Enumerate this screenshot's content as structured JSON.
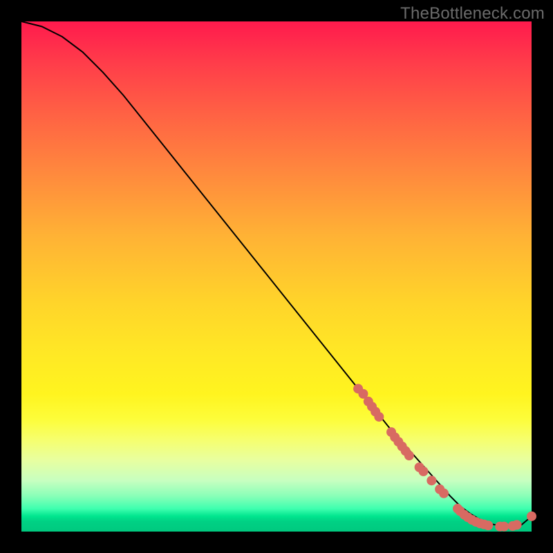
{
  "watermark": "TheBottleneck.com",
  "chart_data": {
    "type": "line",
    "title": "",
    "xlabel": "",
    "ylabel": "",
    "xlim": [
      0,
      100
    ],
    "ylim": [
      0,
      100
    ],
    "grid": false,
    "legend": false,
    "series": [
      {
        "name": "curve",
        "color": "#000000",
        "x": [
          0,
          4,
          8,
          12,
          16,
          20,
          24,
          28,
          32,
          36,
          40,
          44,
          48,
          52,
          56,
          60,
          64,
          68,
          72,
          76,
          80,
          84,
          86,
          88,
          90,
          92,
          94,
          96,
          98,
          100
        ],
        "y": [
          100,
          99,
          97,
          94,
          90,
          85.5,
          80.5,
          75.5,
          70.5,
          65.5,
          60.5,
          55.5,
          50.5,
          45.5,
          40.5,
          35.5,
          30.5,
          25.5,
          20.5,
          16,
          11.5,
          7,
          5,
          3.5,
          2.3,
          1.5,
          1.1,
          1.0,
          1.3,
          3.0
        ]
      }
    ],
    "scatter_points": {
      "name": "markers",
      "color": "#d86a62",
      "radius": 7,
      "points": [
        {
          "x": 66,
          "y": 28
        },
        {
          "x": 67,
          "y": 27
        },
        {
          "x": 68,
          "y": 25.5
        },
        {
          "x": 68.7,
          "y": 24.5
        },
        {
          "x": 69.4,
          "y": 23.5
        },
        {
          "x": 70.1,
          "y": 22.5
        },
        {
          "x": 72.5,
          "y": 19.5
        },
        {
          "x": 73.2,
          "y": 18.5
        },
        {
          "x": 73.9,
          "y": 17.6
        },
        {
          "x": 74.6,
          "y": 16.7
        },
        {
          "x": 75.3,
          "y": 15.8
        },
        {
          "x": 76.0,
          "y": 14.9
        },
        {
          "x": 78.0,
          "y": 12.6
        },
        {
          "x": 78.8,
          "y": 11.8
        },
        {
          "x": 80.4,
          "y": 10.0
        },
        {
          "x": 82.0,
          "y": 8.3
        },
        {
          "x": 82.8,
          "y": 7.5
        },
        {
          "x": 85.5,
          "y": 4.5
        },
        {
          "x": 86.0,
          "y": 4.0
        },
        {
          "x": 86.8,
          "y": 3.3
        },
        {
          "x": 87.5,
          "y": 2.8
        },
        {
          "x": 88.3,
          "y": 2.3
        },
        {
          "x": 89.1,
          "y": 1.9
        },
        {
          "x": 89.9,
          "y": 1.6
        },
        {
          "x": 90.7,
          "y": 1.4
        },
        {
          "x": 91.5,
          "y": 1.2
        },
        {
          "x": 93.8,
          "y": 1.0
        },
        {
          "x": 94.6,
          "y": 1.0
        },
        {
          "x": 96.3,
          "y": 1.1
        },
        {
          "x": 97.1,
          "y": 1.3
        },
        {
          "x": 100.0,
          "y": 3.0
        }
      ]
    }
  }
}
